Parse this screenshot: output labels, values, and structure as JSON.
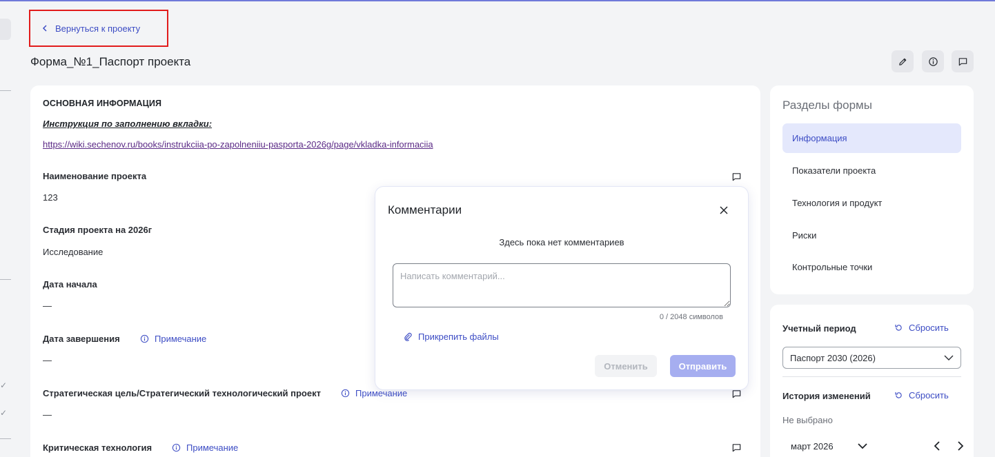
{
  "colors": {
    "accent": "#3c4cc4",
    "highlight_border": "#e11b1b",
    "active_bg": "#e4e8fc",
    "link_visited": "#5b2a86"
  },
  "nav": {
    "back_label": "Вернуться к проекту"
  },
  "page": {
    "title": "Форма_№1_Паспорт проекта"
  },
  "header_actions": [
    {
      "icon": "pencil-icon"
    },
    {
      "icon": "info-icon"
    },
    {
      "icon": "comment-icon"
    }
  ],
  "main": {
    "section_title": "ОСНОВНАЯ ИНФОРМАЦИЯ",
    "instruction_label": "Инструкция по заполнению вкладки:",
    "instruction_link": "https://wiki.sechenov.ru/books/instrukciia-po-zapolneniiu-pasporta-2026g/page/vkladka-informaciia",
    "note_label": "Примечание",
    "fields": [
      {
        "label": "Наименование проекта",
        "value": "123"
      },
      {
        "label": "Стадия проекта на 2026г",
        "value": "Исследование"
      },
      {
        "label": "Дата начала",
        "value": "—"
      },
      {
        "label": "Дата завершения",
        "value": "—"
      },
      {
        "label": "Стратегическая цель/Стратегический технологический проект",
        "value": "—"
      },
      {
        "label": "Критическая технология",
        "value": ""
      }
    ]
  },
  "sections_panel": {
    "title": "Разделы формы",
    "items": [
      {
        "label": "Информация",
        "active": true
      },
      {
        "label": "Показатели проекта"
      },
      {
        "label": "Технология и продукт"
      },
      {
        "label": "Риски"
      },
      {
        "label": "Контрольные точки"
      }
    ]
  },
  "period_panel": {
    "period_label": "Учетный период",
    "reset_label": "Сбросить",
    "selected_period": "Паспорт 2030 (2026)",
    "history_label": "История изменений",
    "history_value": "Не выбрано",
    "month": "март 2026"
  },
  "comments_modal": {
    "title": "Комментарии",
    "empty_text": "Здесь пока нет комментариев",
    "placeholder": "Написать комментарий...",
    "counter": "0 / 2048 символов",
    "attach_label": "Прикрепить файлы",
    "cancel_label": "Отменить",
    "send_label": "Отправить"
  }
}
